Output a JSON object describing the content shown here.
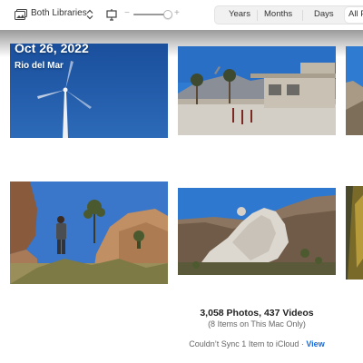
{
  "toolbar": {
    "library_selector": "Both Libraries",
    "zoom": {
      "minus": "−",
      "plus": "+",
      "level": 0.9
    },
    "view_tabs": [
      "Years",
      "Months",
      "Days",
      "All P"
    ]
  },
  "moment": {
    "date": "Oct 26, 2022",
    "location": "Rio del Mar"
  },
  "footer": {
    "count": "3,058 Photos, 437 Videos",
    "sub": "(8 Items on This Mac Only)",
    "sync_text": "Couldn’t Sync 1 Item to iCloud · ",
    "sync_link": "View"
  },
  "colors": {
    "accent": "#1769d6",
    "sky": "#1f57a6"
  },
  "icons": [
    "photo-library-icon",
    "chevron-updown-icon",
    "fit-screen-icon"
  ]
}
